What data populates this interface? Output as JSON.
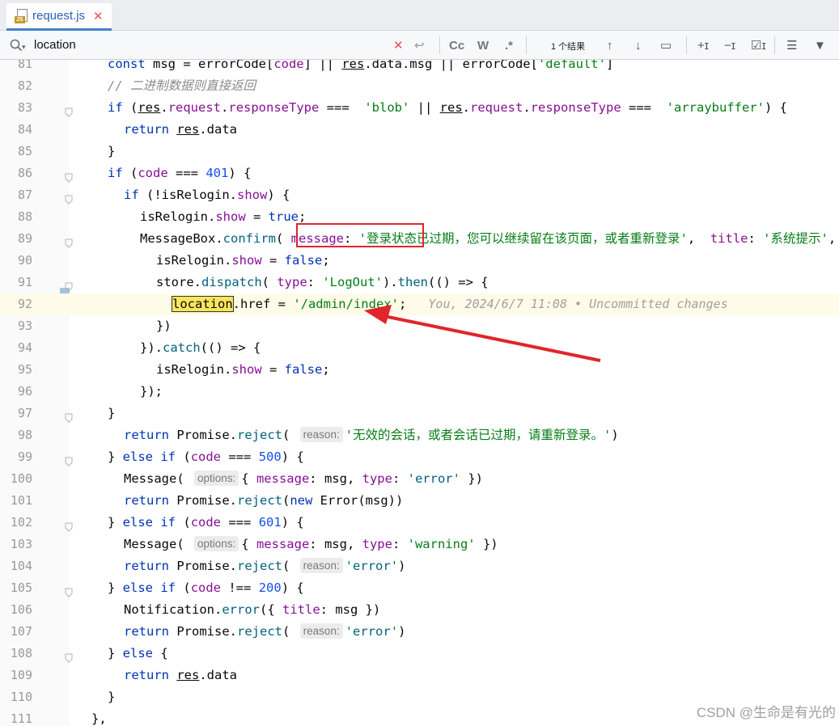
{
  "tab": {
    "file_name": "request.js",
    "icon_label": "JS"
  },
  "search": {
    "value": "location",
    "results": "1 个结果",
    "case_label": "Cc",
    "word_label": "W",
    "regex_label": ".*"
  },
  "lines": [
    {
      "n": "81",
      "code": "    const msg = errorCode[code] || res.data.msg || errorCode['default']"
    },
    {
      "n": "82",
      "code": "// 二进制数据则直接返回"
    },
    {
      "n": "83",
      "code": "if (res.request.responseType ===  'blob' || res.request.responseType ===  'arraybuffer') {"
    },
    {
      "n": "84",
      "code": "  return res.data"
    },
    {
      "n": "85",
      "code": "}"
    },
    {
      "n": "86",
      "code": "if (code === 401) {"
    },
    {
      "n": "87",
      "code": "  if (!isRelogin.show) {"
    },
    {
      "n": "88",
      "code": "    isRelogin.show = true;"
    },
    {
      "n": "89",
      "code": "    MessageBox.confirm( message: '登录状态已过期，您可以继续留在该页面，或者重新登录',  title: '系统提示',"
    },
    {
      "n": "90",
      "code": "      isRelogin.show = false;"
    },
    {
      "n": "91",
      "code": "      store.dispatch( type: 'LogOut').then(() => {"
    },
    {
      "n": "92",
      "code": "        location.href = '/admin/index';"
    },
    {
      "n": "93",
      "code": "      })"
    },
    {
      "n": "94",
      "code": "    }).catch(() => {"
    },
    {
      "n": "95",
      "code": "      isRelogin.show = false;"
    },
    {
      "n": "96",
      "code": "    });"
    },
    {
      "n": "97",
      "code": "  }"
    },
    {
      "n": "98",
      "code": "  return Promise.reject( reason: '无效的会话，或者会话已过期，请重新登录。')"
    },
    {
      "n": "99",
      "code": "} else if (code === 500) {"
    },
    {
      "n": "100",
      "code": "  Message( options: { message: msg, type: 'error' })"
    },
    {
      "n": "101",
      "code": "  return Promise.reject(new Error(msg))"
    },
    {
      "n": "102",
      "code": "} else if (code === 601) {"
    },
    {
      "n": "103",
      "code": "  Message( options: { message: msg, type: 'warning' })"
    },
    {
      "n": "104",
      "code": "  return Promise.reject( reason: 'error')"
    },
    {
      "n": "105",
      "code": "} else if (code !== 200) {"
    },
    {
      "n": "106",
      "code": "  Notification.error({ title: msg })"
    },
    {
      "n": "107",
      "code": "  return Promise.reject( reason: 'error')"
    },
    {
      "n": "108",
      "code": "} else {"
    },
    {
      "n": "109",
      "code": "  return res.data"
    },
    {
      "n": "110",
      "code": "}"
    },
    {
      "n": "111",
      "code": "},"
    }
  ],
  "blame": "You, 2024/6/7 11:08 • Uncommitted changes",
  "watermark": "CSDN @生命是有光的",
  "colors": {
    "accent": "#4083c9",
    "highlight_box": "#e0252c",
    "match_bg": "#f9e55e"
  }
}
